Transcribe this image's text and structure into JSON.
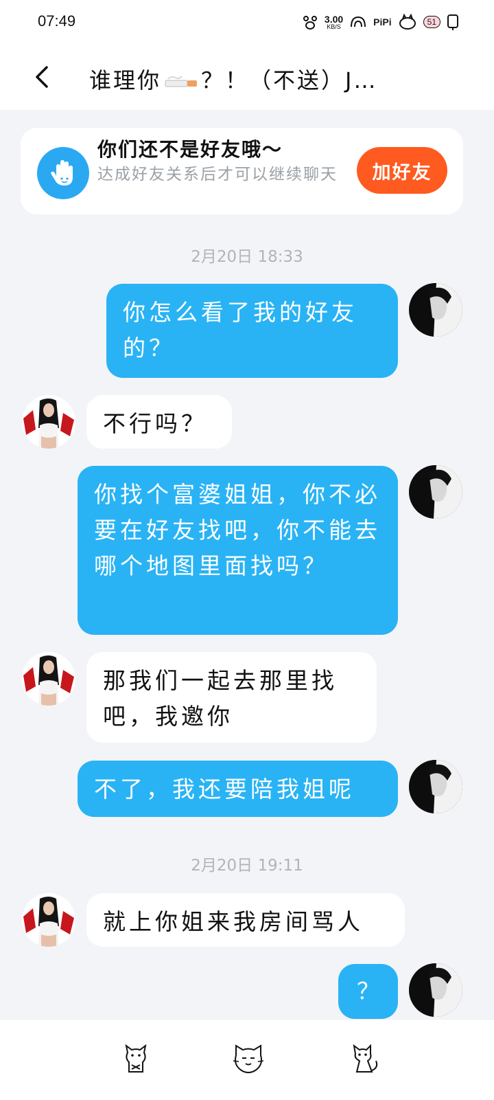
{
  "status_bar": {
    "time": "07:49",
    "net_speed_value": "3.00",
    "net_speed_unit": "KB/S",
    "pipi": "PiPi",
    "battery": "51"
  },
  "header": {
    "title_part1": "谁理你",
    "title_part2": "？！（不送）J…"
  },
  "notice": {
    "title": "你们还不是好友哦～",
    "description": "达成好友关系后才可以继续聊天",
    "button_label": "加好友"
  },
  "messages": {
    "ts1": "2月20日 18:33",
    "m1": "你怎么看了我的好友的？",
    "m2": "不行吗？",
    "m3": "你找个富婆姐姐，你不必要在好友找吧，你不能去哪个地图里面找吗？",
    "m4": "那我们一起去那里找吧，我邀你",
    "m5": "不了，我还要陪我姐呢",
    "ts2": "2月20日 19:11",
    "m6": "就上你姐来我房间骂人",
    "m7": "？"
  },
  "colors": {
    "outgoing_bubble": "#29b3f5",
    "incoming_bubble": "#ffffff",
    "add_friend_button": "#ff5a1f",
    "notice_icon_bg": "#2aa9f2",
    "chat_background": "#f3f4f8"
  },
  "icons": {
    "back": "chevron-left-icon",
    "notice": "hand-icon",
    "bottom_left": "cat-icon",
    "bottom_middle": "cat-face-icon",
    "bottom_right": "cat-sitting-icon"
  }
}
